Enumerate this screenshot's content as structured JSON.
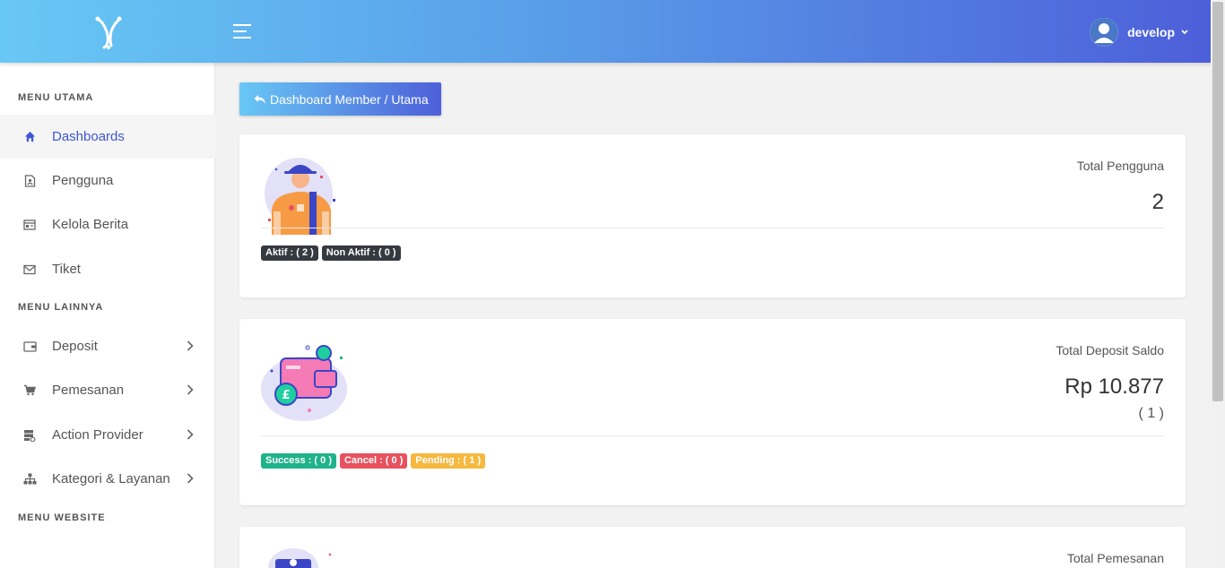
{
  "header": {
    "user_name": "develop"
  },
  "sidebar": {
    "headings": [
      "MENU UTAMA",
      "MENU LAINNYA",
      "MENU WEBSITE"
    ],
    "items": [
      {
        "label": "Dashboards",
        "icon": "home-icon"
      },
      {
        "label": "Pengguna",
        "icon": "user-file-icon"
      },
      {
        "label": "Kelola Berita",
        "icon": "newspaper-icon"
      },
      {
        "label": "Tiket",
        "icon": "mail-icon"
      },
      {
        "label": "Deposit",
        "icon": "wallet-icon"
      },
      {
        "label": "Pemesanan",
        "icon": "cart-icon"
      },
      {
        "label": "Action Provider",
        "icon": "server-icon"
      },
      {
        "label": "Kategori & Layanan",
        "icon": "sitemap-icon"
      }
    ]
  },
  "main": {
    "back_button_label": "Dashboard Member / Utama",
    "cards": [
      {
        "title": "Total Pengguna",
        "value": "2",
        "badges": [
          "Aktif : ( 2 )",
          "Non Aktif : ( 0 )"
        ]
      },
      {
        "title": "Total Deposit Saldo",
        "value": "Rp 10.877",
        "sub": "( 1 )",
        "badges": [
          "Success : ( 0 )",
          "Cancel : ( 0 )",
          "Pending : ( 1 )"
        ]
      },
      {
        "title": "Total Pemesanan"
      }
    ]
  },
  "colors": {
    "accent": "#3f57d4",
    "gradient_start": "#68c8f5",
    "gradient_end": "#4d5fd9",
    "success": "#1fb38a",
    "danger": "#e8525f",
    "warning": "#f5b940",
    "dark": "#343a40"
  }
}
